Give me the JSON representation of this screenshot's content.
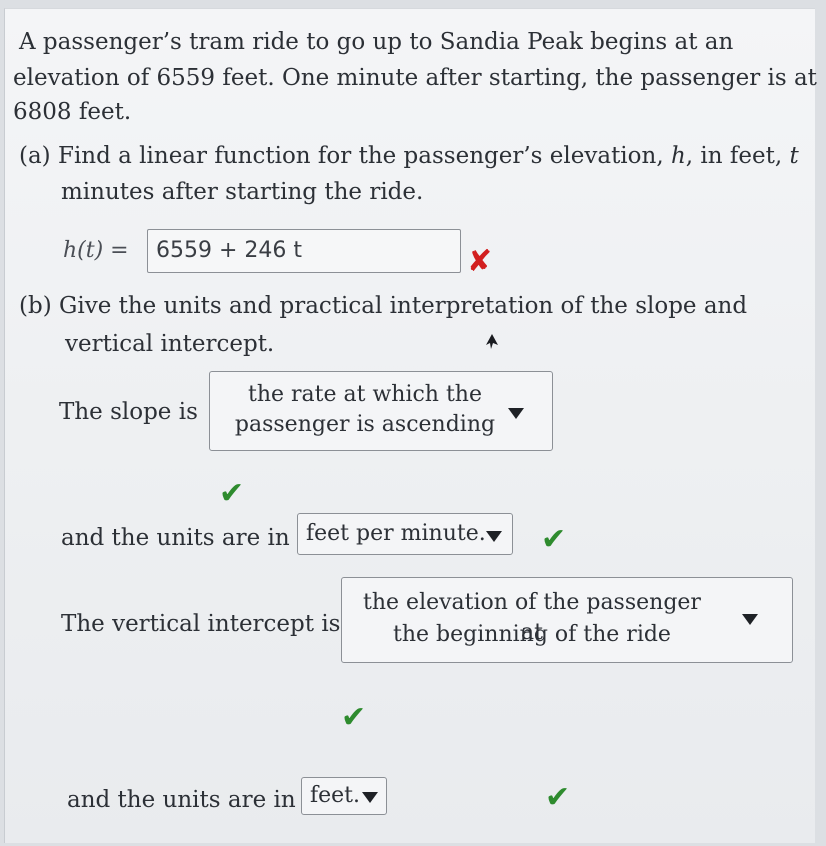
{
  "problem": {
    "line1": "A passenger’s tram ride to go up to Sandia Peak begins at an",
    "line2": "elevation of 6559 feet. One minute after starting, the passenger is at",
    "line3": "6808 feet."
  },
  "part_a": {
    "label": "(a)",
    "line1_prefix": "Find a linear function for the passenger’s elevation,",
    "var_h": "h",
    "mid1": ", in feet,",
    "var_t": "t",
    "line2": "minutes after starting the ride.",
    "function_label": "h(t) =",
    "answer_value": "6559 + 246 t",
    "status_icon": "cross-icon",
    "status_color": "#d21f1f"
  },
  "part_b": {
    "label": "(b)",
    "line1": "Give the units and practical interpretation of the slope and",
    "line2": "vertical intercept.",
    "slope_label": "The slope is",
    "slope_selected_line1": "the rate at which the",
    "slope_selected_line2": "passenger is ascending",
    "slope_units_label": "and the units are in",
    "slope_units_selected": "feet per minute.",
    "intercept_label": "The vertical intercept is",
    "intercept_selected_line1": "the elevation of the passenger at",
    "intercept_selected_line2": "the beginning of the ride",
    "intercept_units_label": "and the units are in",
    "intercept_units_selected": "feet.",
    "correct_color": "#2e8b2e"
  }
}
